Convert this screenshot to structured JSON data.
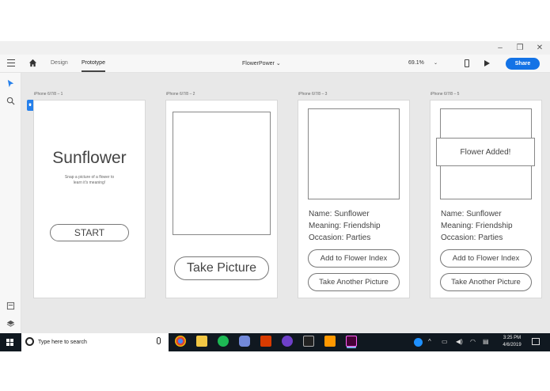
{
  "window": {
    "controls": [
      "–",
      "❐",
      "✕"
    ]
  },
  "header": {
    "tabs": [
      {
        "label": "Design",
        "active": false
      },
      {
        "label": "Prototype",
        "active": true
      }
    ],
    "document_title": "FlowerPower",
    "zoom": "69.1%",
    "share_label": "Share",
    "accent_color": "#1473e6"
  },
  "left_toolbar": {
    "icons": [
      "select-arrow-icon",
      "zoom-icon",
      "assets-icon",
      "layers-icon"
    ]
  },
  "artboards": [
    {
      "label": "iPhone 6/7/8 – 1",
      "title": "Sunflower",
      "subtitle_line1": "Snap a picture of a flower to",
      "subtitle_line2": "learn it's meaning!",
      "button": "START"
    },
    {
      "label": "iPhone 6/7/8 – 2",
      "button": "Take Picture"
    },
    {
      "label": "iPhone 6/7/8 – 3",
      "name": "Name: Sunflower",
      "meaning": "Meaning: Friendship",
      "occasion": "Occasion: Parties",
      "button1": "Add to Flower Index",
      "button2": "Take Another Picture"
    },
    {
      "label": "iPhone 6/7/8 – 5",
      "toast": "Flower Added!",
      "name": "Name: Sunflower",
      "meaning": "Meaning: Friendship",
      "occasion": "Occasion: Parties",
      "button1": "Add to Flower Index",
      "button2": "Take Another Picture"
    }
  ],
  "taskbar": {
    "search_placeholder": "Type here to search",
    "apps": [
      "chrome-icon",
      "file-explorer-icon",
      "spotify-icon",
      "discord-icon",
      "office-icon",
      "github-icon",
      "terminal-icon",
      "sublime-icon",
      "adobe-xd-icon"
    ],
    "time": "3:25 PM",
    "date": "4/6/2019"
  }
}
